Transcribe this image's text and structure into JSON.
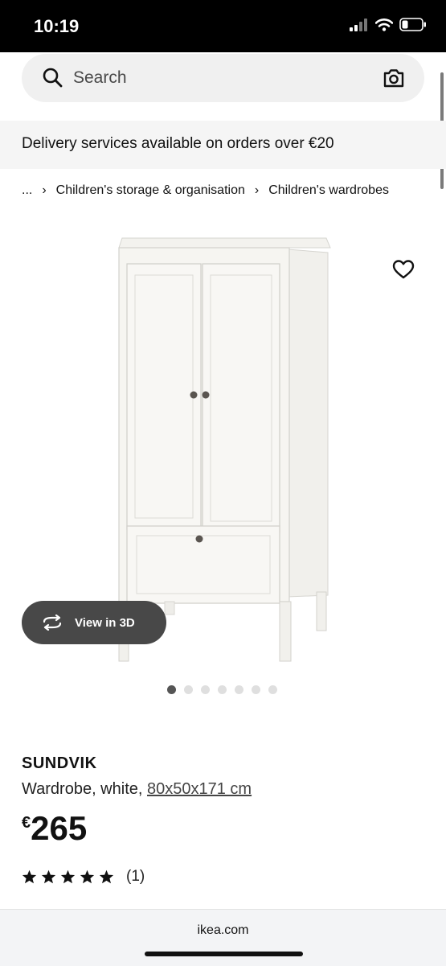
{
  "status_bar": {
    "time": "10:19"
  },
  "search": {
    "placeholder": "Search"
  },
  "banner": {
    "text": "Delivery services available on orders over €20"
  },
  "breadcrumb": {
    "ellipsis": "...",
    "items": [
      "Children's storage & organisation",
      "Children's wardrobes"
    ]
  },
  "gallery": {
    "view_3d_label": "View in 3D",
    "image_count": 7,
    "active_index": 0
  },
  "product": {
    "name": "SUNDVIK",
    "description": "Wardrobe, white, ",
    "dimensions": "80x50x171 cm",
    "currency": "€",
    "price": "265",
    "rating_stars": 5,
    "review_count": "(1)"
  },
  "browser": {
    "url": "ikea.com"
  },
  "icons": [
    "search-icon",
    "camera-icon",
    "heart-icon",
    "rotate-3d-icon",
    "star-icon",
    "signal-icon",
    "wifi-icon",
    "battery-icon"
  ]
}
